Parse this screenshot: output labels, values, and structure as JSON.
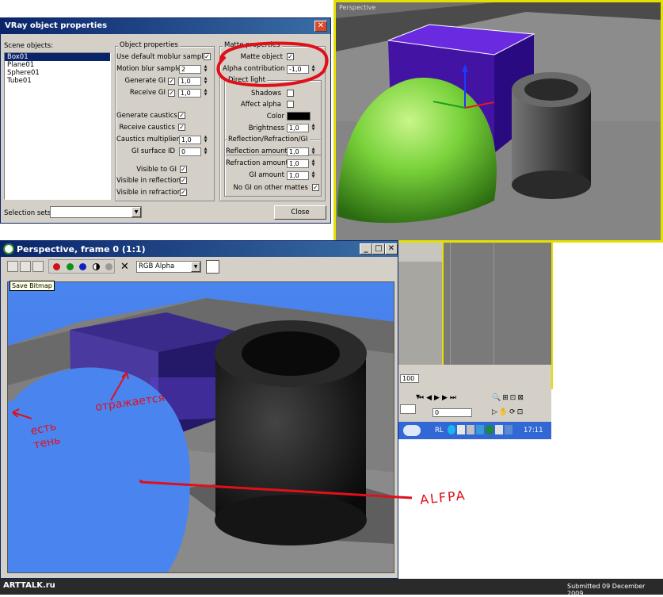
{
  "vray_dialog": {
    "title": "VRay object properties",
    "scene_objects_label": "Scene objects:",
    "scene_objects": [
      "Box01",
      "Plane01",
      "Sphere01",
      "Tube01"
    ],
    "selected_object": "Box01",
    "selection_sets_label": "Selection sets:",
    "selection_sets_value": "",
    "close_label": "Close",
    "object_properties": {
      "title": "Object properties",
      "use_default_moblur": "Use default moblur samples",
      "motion_blur_samples": "Motion blur samples",
      "motion_blur_samples_value": "2",
      "generate_gi": "Generate GI",
      "generate_gi_value": "1,0",
      "receive_gi": "Receive GI",
      "receive_gi_value": "1,0",
      "generate_caustics": "Generate caustics",
      "receive_caustics": "Receive caustics",
      "caustics_multiplier": "Caustics multiplier",
      "caustics_multiplier_value": "1,0",
      "gi_surface_id": "GI surface ID",
      "gi_surface_id_value": "0",
      "visible_to_gi": "Visible to GI",
      "visible_in_reflections": "Visible in reflections",
      "visible_in_refractions": "Visible in refractions"
    },
    "matte_properties": {
      "title": "Matte properties",
      "matte_object": "Matte object",
      "alpha_contribution": "Alpha contribution",
      "alpha_contribution_value": "-1,0",
      "direct_light_title": "Direct light",
      "shadows": "Shadows",
      "affect_alpha": "Affect alpha",
      "color": "Color",
      "brightness": "Brightness",
      "brightness_value": "1,0",
      "rrg_title": "Reflection/Refraction/GI",
      "reflection_amount": "Reflection amount",
      "reflection_amount_value": "1,0",
      "refraction_amount": "Refraction amount",
      "refraction_amount_value": "1,0",
      "gi_amount": "GI amount",
      "gi_amount_value": "1,0",
      "no_gi_on_other_mattes": "No GI on other mattes"
    }
  },
  "viewport": {
    "label": "Perspective"
  },
  "frame_window": {
    "title": "Perspective, frame 0 (1:1)",
    "channel_value": "RGB Alpha",
    "tooltip": "Save Bitmap"
  },
  "timeline": {
    "frame_value": "100",
    "spinner_value": "0"
  },
  "taskbar": {
    "lang": "RL",
    "time": "17:11"
  },
  "footer": {
    "logo": "ARTTALK.ru",
    "submitted": "Submitted 09 December 2009"
  },
  "annotations": {
    "shadow_note": "есть тень",
    "reflection_note": "отражается",
    "alpha_note": "ALFPA"
  },
  "colors": {
    "title_bar": "#0a246a",
    "dialog_bg": "#d4d0c8",
    "viewport_border": "#e6e000",
    "render_bg": "#4a84ef",
    "annotation": "#e0101a",
    "box_purple": "#5a20d0",
    "sphere_green": "#6acb2a"
  }
}
